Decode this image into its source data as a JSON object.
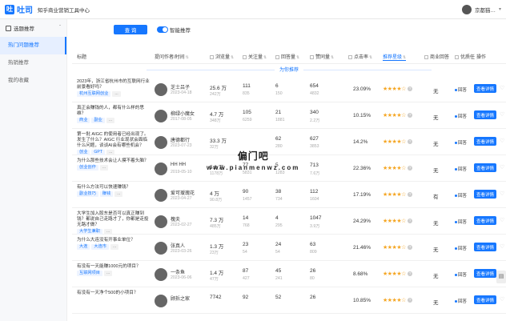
{
  "app": {
    "logo_char": "吐",
    "brand": "吐司",
    "subtitle": "知乎商业营销工具中心",
    "user_name": "京都猫…"
  },
  "sidebar": {
    "section_label": "选题推荐",
    "items": [
      {
        "label": "热门问题推荐",
        "active": true
      },
      {
        "label": "热销推荐",
        "active": false
      },
      {
        "label": "我的收藏",
        "active": false
      }
    ]
  },
  "controls": {
    "query_label": "查 询",
    "toggle_label": "智能推荐"
  },
  "table": {
    "headers": [
      "标题",
      "提问作者/时间",
      "浏览量",
      "关注量",
      "回答量",
      "赞同量",
      "点击率",
      "推荐星级",
      "商业回答",
      "优质任",
      "操作"
    ],
    "sort_glyph": "⇅",
    "recommend_banner": "为你推荐",
    "more_tag": "...",
    "detail_label": "查看详情",
    "status_label": "回答",
    "rows": [
      {
        "title": "2023年，浙江省杭州市的互联网行业前景看好吗？",
        "tags": [
          "杭州互联网创业"
        ],
        "author": "芝士吕子",
        "date": "2023-04-18",
        "views": "25.6 万",
        "views_sub": "242万",
        "follows": "111",
        "follows_sub": "835",
        "answers": "6",
        "answers_sub": "150",
        "likes": "654",
        "likes_sub": "4832",
        "rate": "23.09%",
        "stars": "★★★★☆",
        "biz": "无"
      },
      {
        "title": "真正会赚钱的人，都有什么样的思维？",
        "tags": [
          "商业",
          "副业"
        ],
        "author": "柳绿小魔女",
        "date": "2017-08-05",
        "views": "4.7 万",
        "views_sub": "348万",
        "follows": "105",
        "follows_sub": "6259",
        "answers": "21",
        "answers_sub": "1881",
        "likes": "340",
        "likes_sub": "2.2万",
        "rate": "10.15%",
        "stars": "★★★★☆",
        "biz": "无"
      },
      {
        "title": "第一批 AIGC 的使用者已经出现了。发生了什么？AIGC 行业现状会面临什么问题，谈谈AI会有哪些机会？",
        "tags": [
          "创业",
          "GPT"
        ],
        "author": "唐德都行",
        "date": "2023-07-23",
        "views": "33.3 万",
        "views_sub": "32万",
        "follows": "",
        "follows_sub": "",
        "answers": "62",
        "answers_sub": "280",
        "likes": "627",
        "likes_sub": "3853",
        "rate": "14.2%",
        "stars": "★★★★☆",
        "biz": "无"
      },
      {
        "title": "为什么那些技术会让人摸不着头脑？",
        "tags": [
          "创业创作"
        ],
        "author": "HH HH",
        "date": "2019-05-10",
        "views": "5.9 万",
        "views_sub": "1178万",
        "follows": "77",
        "follows_sub": "5831",
        "answers": "5",
        "answers_sub": "1283",
        "likes": "713",
        "likes_sub": "7.6万",
        "rate": "22.36%",
        "stars": "★★★★☆",
        "biz": "无"
      },
      {
        "title": "有什么方法可以快速赚钱？",
        "tags": [
          "副业技巧",
          "赚钱"
        ],
        "author": "爱可瑷瑰花",
        "date": "2023-04-27",
        "views": "4 万",
        "views_sub": "90.8万",
        "follows": "90",
        "follows_sub": "1457",
        "answers": "38",
        "answers_sub": "734",
        "likes": "112",
        "likes_sub": "1604",
        "rate": "17.19%",
        "stars": "★★★★☆",
        "biz": "有"
      },
      {
        "title": "大学生加入股东是否可以真正赚到钱？都说自己走路才了，你都是走投无路才做？",
        "tags": [
          "大学生兼职"
        ],
        "author": "槐夫",
        "date": "2023-02-27",
        "views": "7.3 万",
        "views_sub": "485万",
        "follows": "14",
        "follows_sub": "768",
        "answers": "4",
        "answers_sub": "295",
        "likes": "1047",
        "likes_sub": "3.9万",
        "rate": "24.29%",
        "stars": "★★★★☆",
        "biz": "无"
      },
      {
        "title": "为什么大连没有开事业单位？",
        "tags": [
          "大连",
          "大连市"
        ],
        "author": "张真人",
        "date": "2023-03-26",
        "views": "1.3 万",
        "views_sub": "23万",
        "follows": "23",
        "follows_sub": "54",
        "answers": "24",
        "answers_sub": "54",
        "likes": "63",
        "likes_sub": "809",
        "rate": "21.46%",
        "stars": "★★★★☆",
        "biz": "无"
      },
      {
        "title": "有没有一天能赚1000元的项目？",
        "tags": [
          "互联网项目"
        ],
        "author": "一条鱼",
        "date": "2023-06-06",
        "views": "1.4 万",
        "views_sub": "47万",
        "follows": "87",
        "follows_sub": "427",
        "answers": "45",
        "answers_sub": "241",
        "likes": "26",
        "likes_sub": "80",
        "rate": "8.68%",
        "stars": "★★★★☆",
        "biz": "无"
      },
      {
        "title": "有没有一天净个500的小项目？",
        "tags": [],
        "author": "顾拆之家",
        "date": "",
        "views": "7742",
        "views_sub": "",
        "follows": "92",
        "follows_sub": "",
        "answers": "52",
        "answers_sub": "",
        "likes": "26",
        "likes_sub": "",
        "rate": "10.85%",
        "stars": "★★★★☆",
        "biz": "无"
      }
    ]
  },
  "watermark": {
    "line1": "偏门吧",
    "line2": "www.pianmenwz.com"
  },
  "colors": {
    "accent": "#1677ff",
    "star": "#f5a623"
  }
}
